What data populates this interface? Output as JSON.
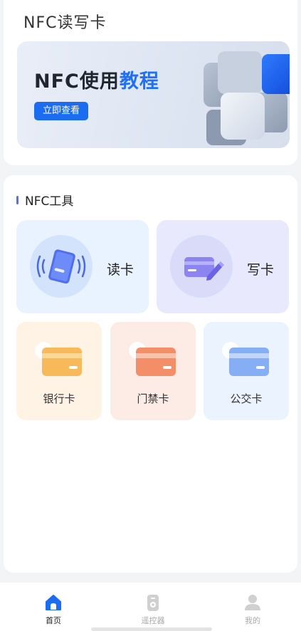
{
  "app": {
    "title": "NFC读写卡"
  },
  "banner": {
    "title_part1": "NFC使用",
    "title_part2": "教程",
    "button_label": "立即查看"
  },
  "tools": {
    "section_title": "NFC工具",
    "read_label": "读卡",
    "write_label": "写卡",
    "cards": [
      {
        "label": "银行卡",
        "icon": "bank-card-icon",
        "color": "#f8b95a"
      },
      {
        "label": "门禁卡",
        "icon": "access-card-icon",
        "color": "#f38e68"
      },
      {
        "label": "公交卡",
        "icon": "bus-card-icon",
        "color": "#86aef5"
      }
    ]
  },
  "tabbar": {
    "items": [
      {
        "label": "首页",
        "icon": "home-icon",
        "active": true
      },
      {
        "label": "遥控器",
        "icon": "remote-icon",
        "active": false
      },
      {
        "label": "我的",
        "icon": "user-icon",
        "active": false
      }
    ]
  },
  "colors": {
    "accent": "#1c6cf2",
    "section_bar": "#5b70e8",
    "page_bg": "#f3f4f6"
  }
}
